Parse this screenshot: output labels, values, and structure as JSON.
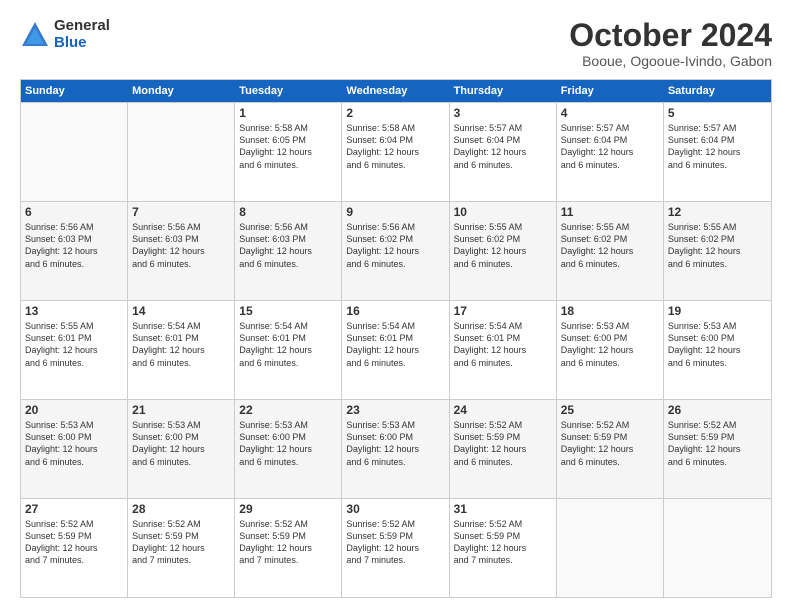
{
  "logo": {
    "general": "General",
    "blue": "Blue"
  },
  "title": "October 2024",
  "location": "Booue, Ogooue-Ivindo, Gabon",
  "days": [
    "Sunday",
    "Monday",
    "Tuesday",
    "Wednesday",
    "Thursday",
    "Friday",
    "Saturday"
  ],
  "weeks": [
    [
      {
        "day": "",
        "info": ""
      },
      {
        "day": "",
        "info": ""
      },
      {
        "day": "1",
        "info": "Sunrise: 5:58 AM\nSunset: 6:05 PM\nDaylight: 12 hours\nand 6 minutes."
      },
      {
        "day": "2",
        "info": "Sunrise: 5:58 AM\nSunset: 6:04 PM\nDaylight: 12 hours\nand 6 minutes."
      },
      {
        "day": "3",
        "info": "Sunrise: 5:57 AM\nSunset: 6:04 PM\nDaylight: 12 hours\nand 6 minutes."
      },
      {
        "day": "4",
        "info": "Sunrise: 5:57 AM\nSunset: 6:04 PM\nDaylight: 12 hours\nand 6 minutes."
      },
      {
        "day": "5",
        "info": "Sunrise: 5:57 AM\nSunset: 6:04 PM\nDaylight: 12 hours\nand 6 minutes."
      }
    ],
    [
      {
        "day": "6",
        "info": "Sunrise: 5:56 AM\nSunset: 6:03 PM\nDaylight: 12 hours\nand 6 minutes."
      },
      {
        "day": "7",
        "info": "Sunrise: 5:56 AM\nSunset: 6:03 PM\nDaylight: 12 hours\nand 6 minutes."
      },
      {
        "day": "8",
        "info": "Sunrise: 5:56 AM\nSunset: 6:03 PM\nDaylight: 12 hours\nand 6 minutes."
      },
      {
        "day": "9",
        "info": "Sunrise: 5:56 AM\nSunset: 6:02 PM\nDaylight: 12 hours\nand 6 minutes."
      },
      {
        "day": "10",
        "info": "Sunrise: 5:55 AM\nSunset: 6:02 PM\nDaylight: 12 hours\nand 6 minutes."
      },
      {
        "day": "11",
        "info": "Sunrise: 5:55 AM\nSunset: 6:02 PM\nDaylight: 12 hours\nand 6 minutes."
      },
      {
        "day": "12",
        "info": "Sunrise: 5:55 AM\nSunset: 6:02 PM\nDaylight: 12 hours\nand 6 minutes."
      }
    ],
    [
      {
        "day": "13",
        "info": "Sunrise: 5:55 AM\nSunset: 6:01 PM\nDaylight: 12 hours\nand 6 minutes."
      },
      {
        "day": "14",
        "info": "Sunrise: 5:54 AM\nSunset: 6:01 PM\nDaylight: 12 hours\nand 6 minutes."
      },
      {
        "day": "15",
        "info": "Sunrise: 5:54 AM\nSunset: 6:01 PM\nDaylight: 12 hours\nand 6 minutes."
      },
      {
        "day": "16",
        "info": "Sunrise: 5:54 AM\nSunset: 6:01 PM\nDaylight: 12 hours\nand 6 minutes."
      },
      {
        "day": "17",
        "info": "Sunrise: 5:54 AM\nSunset: 6:01 PM\nDaylight: 12 hours\nand 6 minutes."
      },
      {
        "day": "18",
        "info": "Sunrise: 5:53 AM\nSunset: 6:00 PM\nDaylight: 12 hours\nand 6 minutes."
      },
      {
        "day": "19",
        "info": "Sunrise: 5:53 AM\nSunset: 6:00 PM\nDaylight: 12 hours\nand 6 minutes."
      }
    ],
    [
      {
        "day": "20",
        "info": "Sunrise: 5:53 AM\nSunset: 6:00 PM\nDaylight: 12 hours\nand 6 minutes."
      },
      {
        "day": "21",
        "info": "Sunrise: 5:53 AM\nSunset: 6:00 PM\nDaylight: 12 hours\nand 6 minutes."
      },
      {
        "day": "22",
        "info": "Sunrise: 5:53 AM\nSunset: 6:00 PM\nDaylight: 12 hours\nand 6 minutes."
      },
      {
        "day": "23",
        "info": "Sunrise: 5:53 AM\nSunset: 6:00 PM\nDaylight: 12 hours\nand 6 minutes."
      },
      {
        "day": "24",
        "info": "Sunrise: 5:52 AM\nSunset: 5:59 PM\nDaylight: 12 hours\nand 6 minutes."
      },
      {
        "day": "25",
        "info": "Sunrise: 5:52 AM\nSunset: 5:59 PM\nDaylight: 12 hours\nand 6 minutes."
      },
      {
        "day": "26",
        "info": "Sunrise: 5:52 AM\nSunset: 5:59 PM\nDaylight: 12 hours\nand 6 minutes."
      }
    ],
    [
      {
        "day": "27",
        "info": "Sunrise: 5:52 AM\nSunset: 5:59 PM\nDaylight: 12 hours\nand 7 minutes."
      },
      {
        "day": "28",
        "info": "Sunrise: 5:52 AM\nSunset: 5:59 PM\nDaylight: 12 hours\nand 7 minutes."
      },
      {
        "day": "29",
        "info": "Sunrise: 5:52 AM\nSunset: 5:59 PM\nDaylight: 12 hours\nand 7 minutes."
      },
      {
        "day": "30",
        "info": "Sunrise: 5:52 AM\nSunset: 5:59 PM\nDaylight: 12 hours\nand 7 minutes."
      },
      {
        "day": "31",
        "info": "Sunrise: 5:52 AM\nSunset: 5:59 PM\nDaylight: 12 hours\nand 7 minutes."
      },
      {
        "day": "",
        "info": ""
      },
      {
        "day": "",
        "info": ""
      }
    ]
  ]
}
